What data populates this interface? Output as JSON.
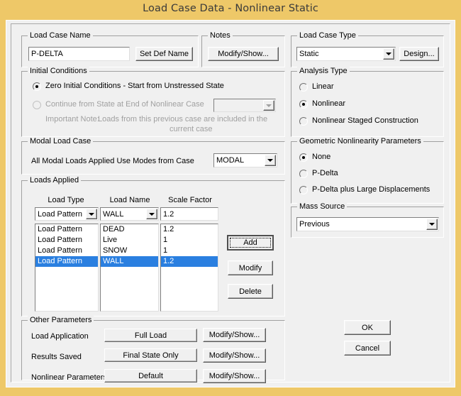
{
  "window": {
    "title": "Load Case Data - Nonlinear Static"
  },
  "load_case_name": {
    "group_label": "Load Case Name",
    "value": "P-DELTA",
    "set_def_name_button": "Set Def Name"
  },
  "notes": {
    "group_label": "Notes",
    "modify_show_button": "Modify/Show..."
  },
  "load_case_type": {
    "group_label": "Load Case Type",
    "selected": "Static",
    "design_button": "Design..."
  },
  "initial_conditions": {
    "group_label": "Initial Conditions",
    "zero_option": "Zero Initial Conditions - Start from Unstressed State",
    "continue_option": "Continue from State at End of Nonlinear Case",
    "continue_case_value": "",
    "note_label": "Important Note:",
    "note_line1": "Loads from this previous case are included in the",
    "note_line2": "current case"
  },
  "analysis_type": {
    "group_label": "Analysis Type",
    "options": [
      "Linear",
      "Nonlinear",
      "Nonlinear Staged Construction"
    ],
    "selected": "Nonlinear"
  },
  "modal_load_case": {
    "group_label": "Modal Load Case",
    "label": "All Modal Loads Applied Use Modes from Case",
    "selected": "MODAL"
  },
  "geometric_nonlinearity": {
    "group_label": "Geometric Nonlinearity Parameters",
    "options": [
      "None",
      "P-Delta",
      "P-Delta plus Large Displacements"
    ],
    "selected": "None"
  },
  "mass_source": {
    "group_label": "Mass Source",
    "selected": "Previous"
  },
  "loads_applied": {
    "group_label": "Loads Applied",
    "columns": [
      "Load Type",
      "Load Name",
      "Scale Factor"
    ],
    "editor": {
      "load_type": "Load Pattern",
      "load_name": "WALL",
      "scale_factor": "1.2"
    },
    "rows": [
      {
        "load_type": "Load Pattern",
        "load_name": "DEAD",
        "scale_factor": "1.2",
        "selected": false
      },
      {
        "load_type": "Load Pattern",
        "load_name": "Live",
        "scale_factor": "1",
        "selected": false
      },
      {
        "load_type": "Load Pattern",
        "load_name": "SNOW",
        "scale_factor": "1",
        "selected": false
      },
      {
        "load_type": "Load Pattern",
        "load_name": "WALL",
        "scale_factor": "1.2",
        "selected": true
      }
    ],
    "add_button": "Add",
    "modify_button": "Modify",
    "delete_button": "Delete"
  },
  "other_parameters": {
    "group_label": "Other Parameters",
    "rows": [
      {
        "label": "Load Application",
        "value": "Full Load",
        "button": "Modify/Show..."
      },
      {
        "label": "Results Saved",
        "value": "Final State Only",
        "button": "Modify/Show..."
      },
      {
        "label": "Nonlinear Parameters",
        "value": "Default",
        "button": "Modify/Show..."
      }
    ]
  },
  "dialog_buttons": {
    "ok": "OK",
    "cancel": "Cancel"
  },
  "colors": {
    "title_bar": "#eec868",
    "dialog_face": "#f0f0f0",
    "selection": "#2a7fe0",
    "disabled_text": "#a0a0a0"
  }
}
